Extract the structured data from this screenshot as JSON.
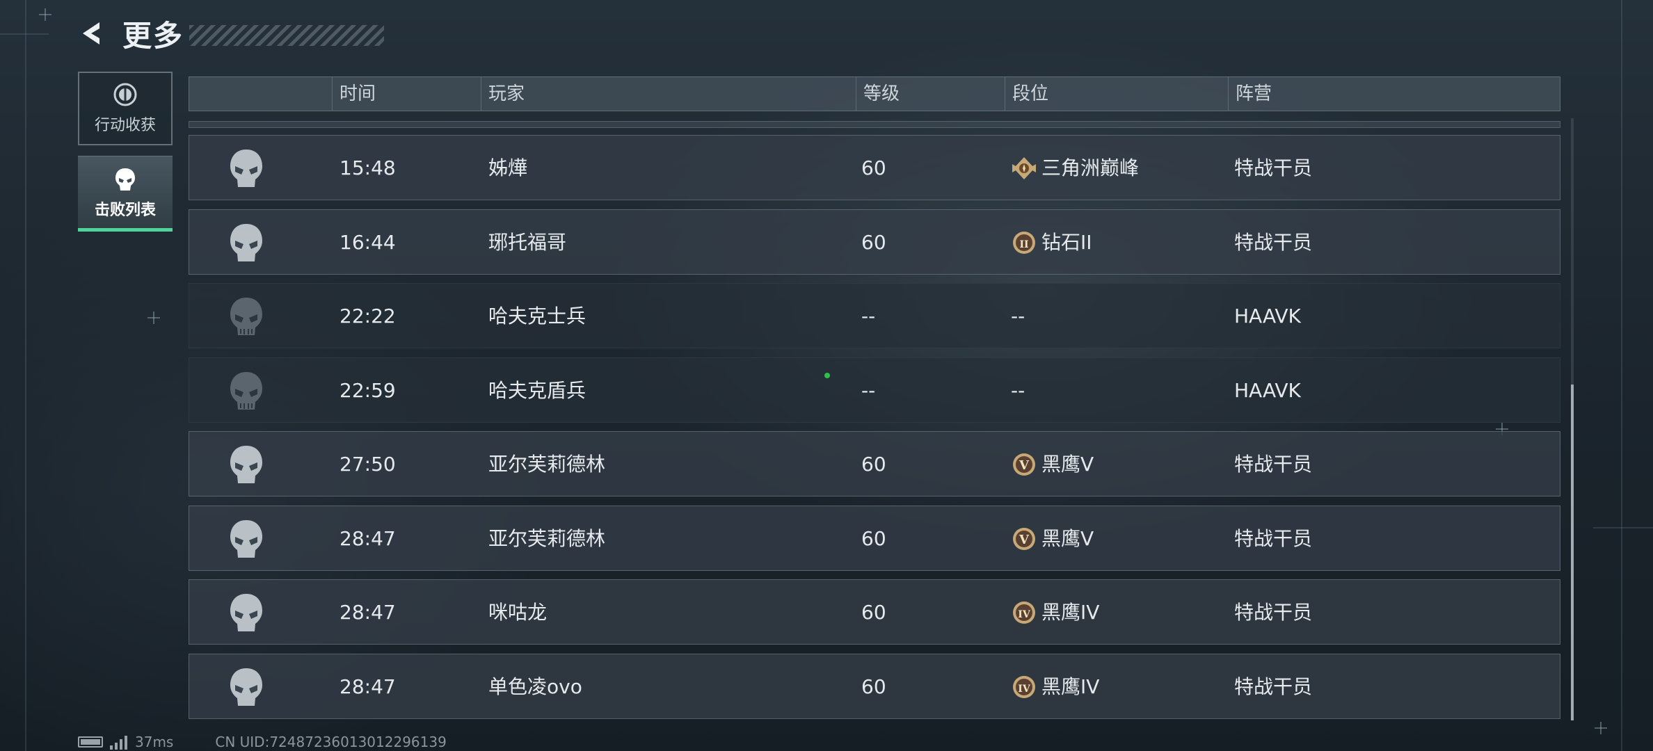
{
  "header": {
    "title": "更多",
    "back_icon": "back-chevron-icon"
  },
  "sidebar": {
    "items": [
      {
        "label": "行动收获",
        "icon": "loot-icon",
        "active": false
      },
      {
        "label": "击败列表",
        "icon": "skull-icon",
        "active": true
      }
    ]
  },
  "table": {
    "columns": [
      "时间",
      "玩家",
      "等级",
      "段位",
      "阵营"
    ],
    "rows": [
      {
        "time": "15:48",
        "player": "姊燁",
        "level": "60",
        "rank": "三角洲巅峰",
        "rank_badge": "peak",
        "faction": "特战干员",
        "dim": false
      },
      {
        "time": "16:44",
        "player": "琊托福哥",
        "level": "60",
        "rank": "钻石II",
        "rank_badge": "II",
        "faction": "特战干员",
        "dim": false
      },
      {
        "time": "22:22",
        "player": "哈夫克士兵",
        "level": "--",
        "rank": "--",
        "rank_badge": "",
        "faction": "HAAVK",
        "dim": true
      },
      {
        "time": "22:59",
        "player": "哈夫克盾兵",
        "level": "--",
        "rank": "--",
        "rank_badge": "",
        "faction": "HAAVK",
        "dim": true
      },
      {
        "time": "27:50",
        "player": "亚尔芙莉德林",
        "level": "60",
        "rank": "黑鹰V",
        "rank_badge": "V",
        "faction": "特战干员",
        "dim": false
      },
      {
        "time": "28:47",
        "player": "亚尔芙莉德林",
        "level": "60",
        "rank": "黑鹰V",
        "rank_badge": "V",
        "faction": "特战干员",
        "dim": false
      },
      {
        "time": "28:47",
        "player": "咪咕龙",
        "level": "60",
        "rank": "黑鹰IV",
        "rank_badge": "IV",
        "faction": "特战干员",
        "dim": false
      },
      {
        "time": "28:47",
        "player": "单色凌ovo",
        "level": "60",
        "rank": "黑鹰IV",
        "rank_badge": "IV",
        "faction": "特战干员",
        "dim": false
      }
    ]
  },
  "footer": {
    "ping": "37ms",
    "uid": "CN UID:7248723601301229613​9"
  },
  "colors": {
    "accent": "#4fd49a",
    "rank_badge": "#c7a877"
  }
}
